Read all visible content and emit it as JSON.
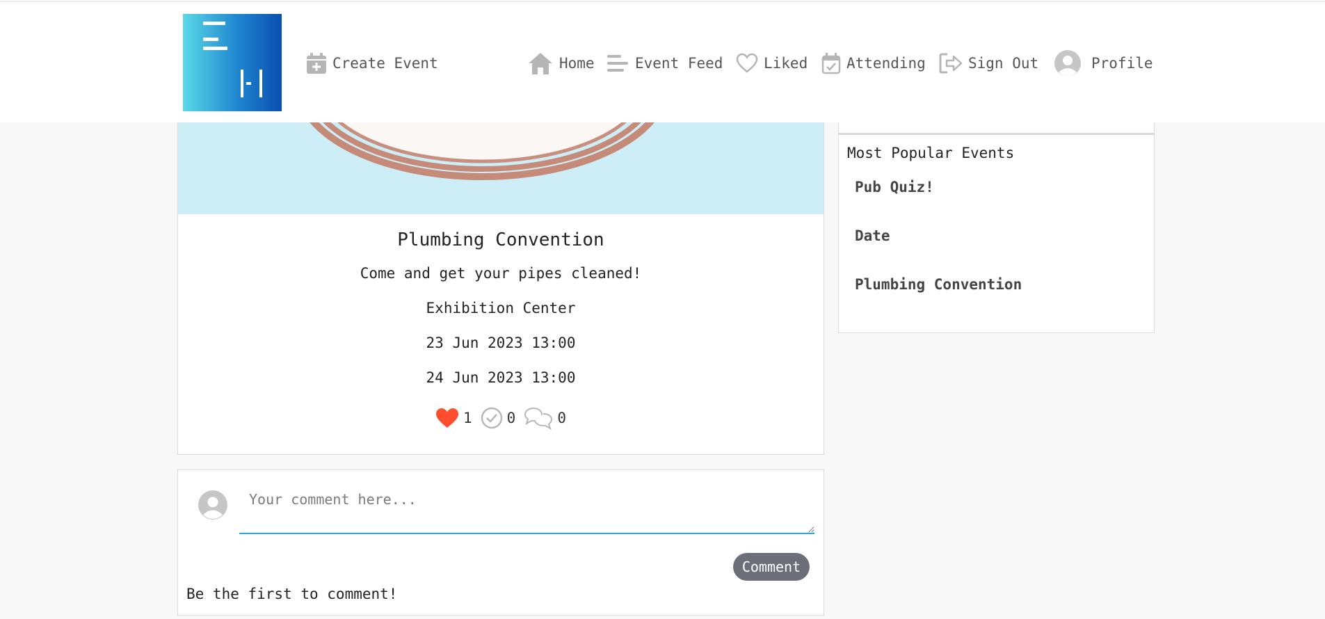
{
  "nav": {
    "create_event": "Create Event",
    "home": "Home",
    "event_feed": "Event Feed",
    "liked": "Liked",
    "attending": "Attending",
    "sign_out": "Sign Out",
    "profile": "Profile"
  },
  "event": {
    "title": "Plumbing Convention",
    "description": "Come and get your pipes cleaned!",
    "location": "Exhibition Center",
    "start": "23 Jun 2023 13:00",
    "end": "24 Jun 2023 13:00",
    "likes": "1",
    "attending": "0",
    "comments": "0"
  },
  "comment_form": {
    "placeholder": "Your comment here...",
    "button": "Comment",
    "empty_message": "Be the first to comment!"
  },
  "sidebar": {
    "heading": "Most Popular Events",
    "items": [
      "Pub Quiz!",
      "Date",
      "Plumbing Convention"
    ]
  },
  "colors": {
    "accent_heart": "#ff4d2e",
    "input_underline": "#2aa8e0",
    "button": "#6c6f7a",
    "banner": "#cdeef7"
  }
}
